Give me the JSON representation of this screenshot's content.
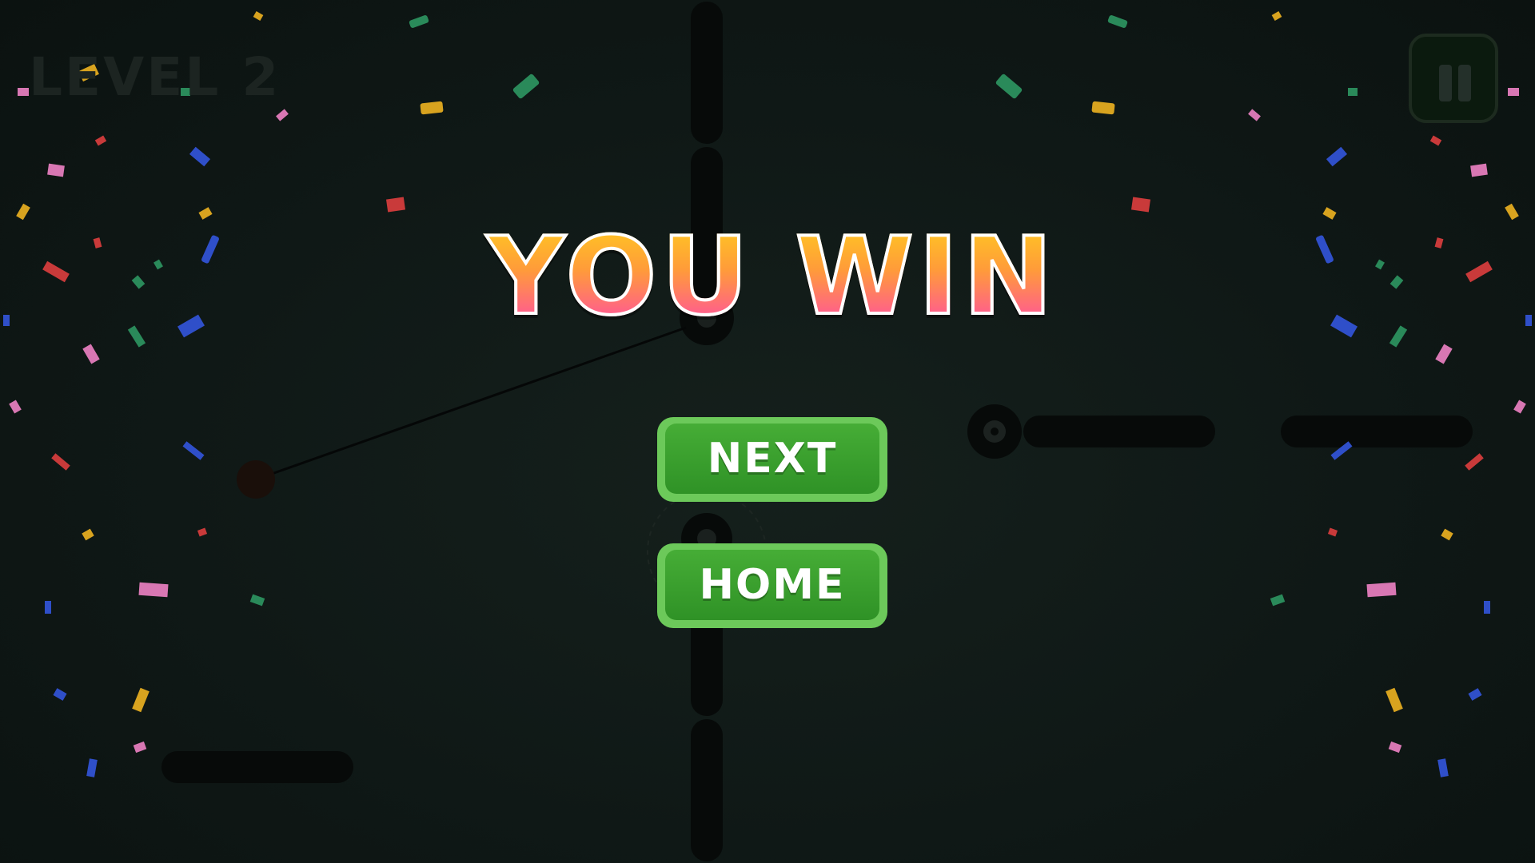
{
  "hud": {
    "level_label": "LEVEL 2"
  },
  "win_screen": {
    "title": "YOU WIN",
    "next_label": "NEXT",
    "home_label": "HOME"
  },
  "icons": {
    "pause": "pause-icon"
  },
  "colors": {
    "background": "#0f1816",
    "title_gradient_top": "#ffd21c",
    "title_gradient_bottom": "#ff3fb7",
    "button_green": "#46ad36",
    "confetti": [
      "#2a8a5a",
      "#d8a31f",
      "#c93a3a",
      "#d877b3",
      "#2f4fc9"
    ]
  }
}
